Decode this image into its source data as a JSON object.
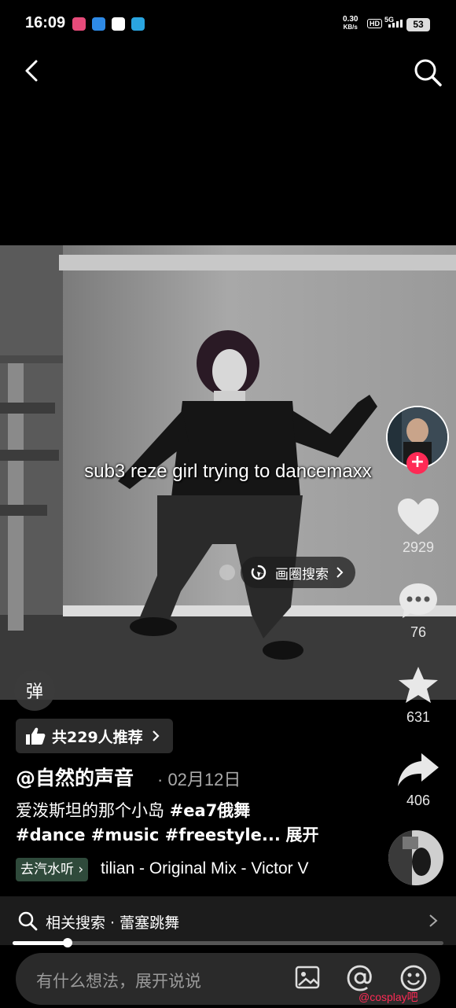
{
  "status_bar": {
    "time": "16:09",
    "net_speed": "0.30",
    "net_unit": "KB/s",
    "hd": "HD",
    "signal": "5G",
    "battery": "53"
  },
  "video": {
    "caption": "sub3 reze girl trying to dancemaxx",
    "circle_search_label": "画圈搜索",
    "danmu_label": "弹"
  },
  "actions": {
    "likes": "2929",
    "comments": "76",
    "favorites": "631",
    "shares": "406"
  },
  "info": {
    "recommend_label": "共229人推荐",
    "author": "@自然的声音",
    "date": "· 02月12日",
    "description_line1": "爱泼斯坦的那个小岛",
    "tag_ea7": "#ea7俄舞",
    "description_line2": "#dance #music #freestyle...",
    "expand_label": "展开",
    "music_tag": "去汽水听",
    "music_title": "tilian - Original Mix - Victor V"
  },
  "related": {
    "label": "相关搜索 · 蕾塞跳舞"
  },
  "comment_bar": {
    "placeholder": "有什么想法，展开说说"
  },
  "watermark": "@cosplay吧"
}
